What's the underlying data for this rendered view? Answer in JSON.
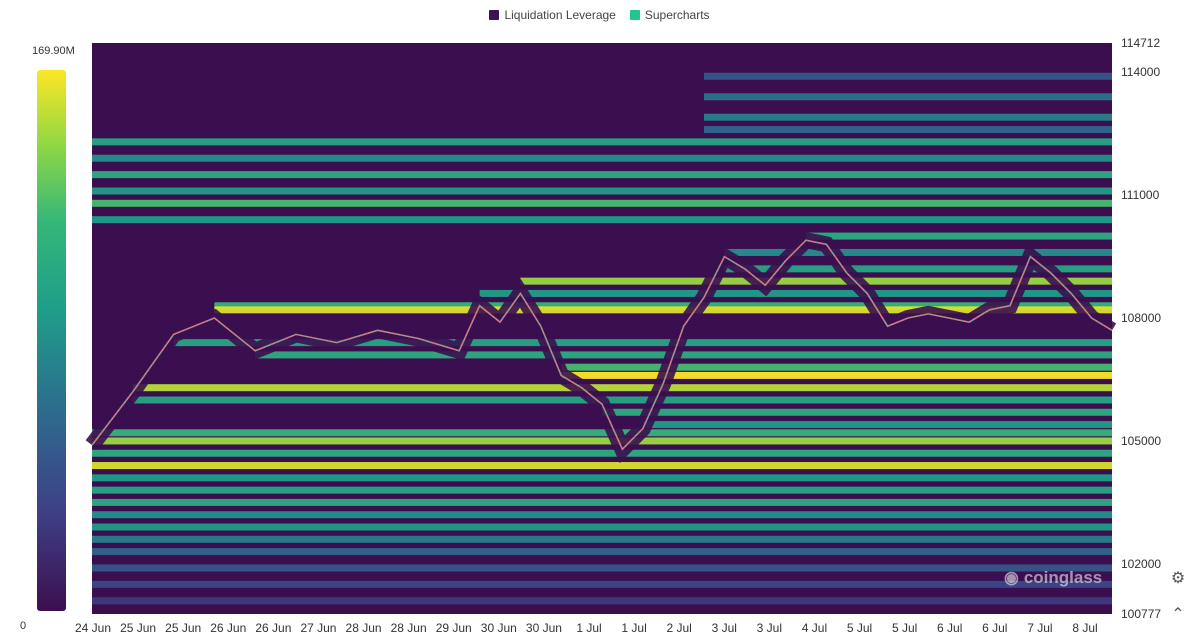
{
  "legend": [
    {
      "label": "Liquidation Leverage",
      "color": "#3b1255"
    },
    {
      "label": "Supercharts",
      "color": "#22c58b"
    }
  ],
  "colorbar": {
    "max_label": "169.90M",
    "min_label": "0"
  },
  "watermark": "coinglass",
  "controls": {
    "settings_icon": "settings-icon",
    "collapse_icon": "chevron-up-icon"
  },
  "chart_data": {
    "type": "heatmap",
    "title": "",
    "x_ticks": [
      "24 Jun",
      "25 Jun",
      "25 Jun",
      "26 Jun",
      "26 Jun",
      "27 Jun",
      "28 Jun",
      "28 Jun",
      "29 Jun",
      "30 Jun",
      "30 Jun",
      "1 Jul",
      "1 Jul",
      "2 Jul",
      "3 Jul",
      "3 Jul",
      "4 Jul",
      "5 Jul",
      "5 Jul",
      "6 Jul",
      "6 Jul",
      "7 Jul",
      "8 Jul"
    ],
    "y_ticks": [
      114712,
      114000,
      111000,
      108000,
      105000,
      102000,
      100777
    ],
    "ylim": [
      100777,
      114712
    ],
    "colorscale_range": [
      0,
      169900000
    ],
    "colorscale": [
      "#3b0f4f",
      "#3f3f86",
      "#2c6e8e",
      "#1f9e89",
      "#35b779",
      "#8fd744",
      "#fde725"
    ],
    "price_path": [
      [
        0,
        104.9
      ],
      [
        4,
        106.2
      ],
      [
        8,
        107.6
      ],
      [
        12,
        108.0
      ],
      [
        16,
        107.2
      ],
      [
        20,
        107.6
      ],
      [
        24,
        107.4
      ],
      [
        28,
        107.7
      ],
      [
        32,
        107.5
      ],
      [
        36,
        107.2
      ],
      [
        38,
        108.3
      ],
      [
        40,
        107.9
      ],
      [
        42,
        108.6
      ],
      [
        44,
        107.8
      ],
      [
        46,
        106.6
      ],
      [
        48,
        106.3
      ],
      [
        50,
        105.9
      ],
      [
        52,
        104.8
      ],
      [
        54,
        105.3
      ],
      [
        56,
        106.4
      ],
      [
        58,
        107.8
      ],
      [
        60,
        108.5
      ],
      [
        62,
        109.5
      ],
      [
        64,
        109.2
      ],
      [
        66,
        108.8
      ],
      [
        68,
        109.4
      ],
      [
        70,
        109.9
      ],
      [
        72,
        109.8
      ],
      [
        74,
        109.1
      ],
      [
        76,
        108.6
      ],
      [
        78,
        107.8
      ],
      [
        80,
        108.0
      ],
      [
        82,
        108.1
      ],
      [
        84,
        108.0
      ],
      [
        86,
        107.9
      ],
      [
        88,
        108.2
      ],
      [
        90,
        108.3
      ],
      [
        92,
        109.5
      ],
      [
        94,
        109.1
      ],
      [
        96,
        108.6
      ],
      [
        98,
        108.0
      ],
      [
        100,
        107.7
      ]
    ],
    "liquidation_levels": [
      {
        "price": 113.9,
        "intensity": 0.25
      },
      {
        "price": 113.4,
        "intensity": 0.35
      },
      {
        "price": 112.9,
        "intensity": 0.4
      },
      {
        "price": 112.6,
        "intensity": 0.3
      },
      {
        "price": 112.3,
        "intensity": 0.55
      },
      {
        "price": 111.9,
        "intensity": 0.45
      },
      {
        "price": 111.5,
        "intensity": 0.6
      },
      {
        "price": 111.1,
        "intensity": 0.5
      },
      {
        "price": 110.8,
        "intensity": 0.7
      },
      {
        "price": 110.4,
        "intensity": 0.5
      },
      {
        "price": 110.0,
        "intensity": 0.6
      },
      {
        "price": 109.6,
        "intensity": 0.45
      },
      {
        "price": 109.2,
        "intensity": 0.55
      },
      {
        "price": 108.9,
        "intensity": 0.85
      },
      {
        "price": 108.6,
        "intensity": 0.5
      },
      {
        "price": 108.3,
        "intensity": 0.65
      },
      {
        "price": 108.2,
        "intensity": 0.95
      },
      {
        "price": 107.4,
        "intensity": 0.55
      },
      {
        "price": 107.1,
        "intensity": 0.6
      },
      {
        "price": 106.8,
        "intensity": 0.7
      },
      {
        "price": 106.6,
        "intensity": 1.0
      },
      {
        "price": 106.3,
        "intensity": 0.9
      },
      {
        "price": 106.0,
        "intensity": 0.55
      },
      {
        "price": 105.7,
        "intensity": 0.6
      },
      {
        "price": 105.4,
        "intensity": 0.5
      },
      {
        "price": 105.2,
        "intensity": 0.65
      },
      {
        "price": 105.0,
        "intensity": 0.85
      },
      {
        "price": 104.7,
        "intensity": 0.6
      },
      {
        "price": 104.4,
        "intensity": 0.95
      },
      {
        "price": 104.1,
        "intensity": 0.5
      },
      {
        "price": 103.8,
        "intensity": 0.55
      },
      {
        "price": 103.5,
        "intensity": 0.6
      },
      {
        "price": 103.2,
        "intensity": 0.45
      },
      {
        "price": 102.9,
        "intensity": 0.5
      },
      {
        "price": 102.6,
        "intensity": 0.4
      },
      {
        "price": 102.3,
        "intensity": 0.3
      },
      {
        "price": 101.9,
        "intensity": 0.25
      },
      {
        "price": 101.5,
        "intensity": 0.2
      },
      {
        "price": 101.1,
        "intensity": 0.15
      }
    ]
  }
}
